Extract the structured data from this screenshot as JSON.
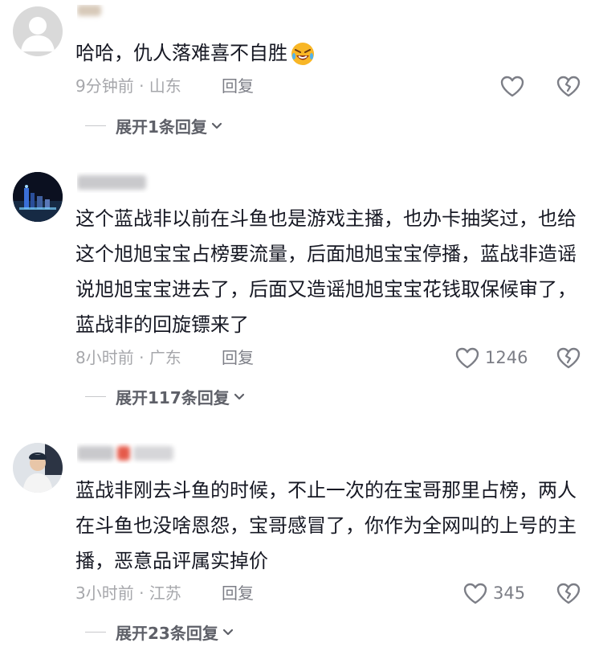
{
  "comments": [
    {
      "text": "哈哈，仇人落难喜不自胜",
      "emoji": "laughing-crying-emoji",
      "meta": "9分钟前 · 山东",
      "reply_label": "回复",
      "like_count": "",
      "expand_label": "展开1条回复"
    },
    {
      "text": "这个蓝战非以前在斗鱼也是游戏主播，也办卡抽奖过，也给这个旭旭宝宝占榜要流量，后面旭旭宝宝停播，蓝战非造谣说旭旭宝宝进去了，后面又造谣旭旭宝宝花钱取保候审了，蓝战非的回旋镖来了",
      "meta": "8小时前 · 广东",
      "reply_label": "回复",
      "like_count": "1246",
      "expand_label": "展开117条回复"
    },
    {
      "text": "蓝战非刚去斗鱼的时候，不止一次的在宝哥那里占榜，两人在斗鱼也没啥恩怨，宝哥感冒了，你作为全网叫的上号的主播，恶意品评属实掉价",
      "meta": "3小时前 · 江苏",
      "reply_label": "回复",
      "like_count": "345",
      "expand_label": "展开23条回复"
    }
  ],
  "icons": {
    "like": "heart-outline-icon",
    "dislike": "broken-heart-icon",
    "expand": "chevron-down-icon"
  },
  "colors": {
    "text": "#161823",
    "meta": "#a6a7ab",
    "action": "#7c7e86",
    "expand": "#5e6068"
  }
}
